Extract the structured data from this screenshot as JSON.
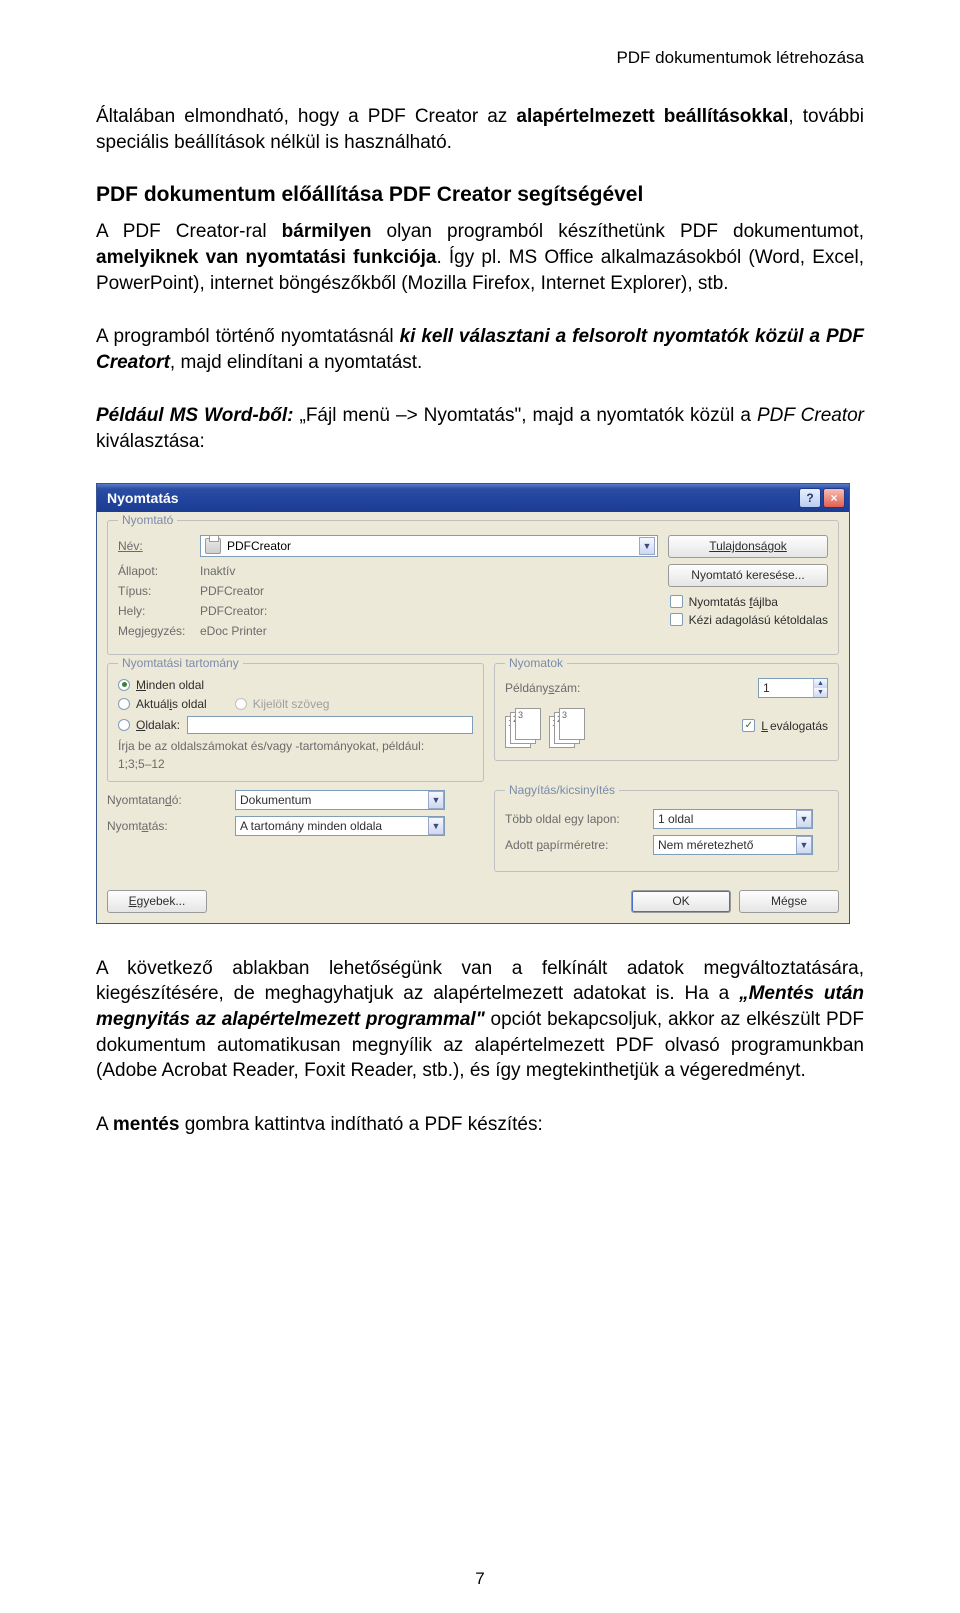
{
  "header_right": "PDF dokumentumok létrehozása",
  "p1_a": "Általában elmondható, hogy a PDF Creator az ",
  "p1_b": "alapértelmezett beállításokkal",
  "p1_c": ", további speciális beállítások nélkül is használható.",
  "h2": "PDF dokumentum előállítása PDF Creator segítségével",
  "p2_a": "A PDF Creator-ral ",
  "p2_b": "bármilyen",
  "p2_c": " olyan programból készíthetünk PDF dokumentumot, ",
  "p2_d": "amelyiknek van nyomtatási funkciója",
  "p2_e": ". Így pl. MS Office alkalmazásokból (Word, Excel, PowerPoint), internet böngészőkből (Mozilla Firefox, Internet Explorer), stb.",
  "p3_a": "A programból történő nyomtatásnál ",
  "p3_b": "ki kell választani a felsorolt nyomtatók közül a PDF Creatort",
  "p3_c": ", majd elindítani a nyomtatást.",
  "p4_a": "Például MS Word-ből:",
  "p4_b": " „Fájl menü –> Nyomtatás\", majd a nyomtatók közül a ",
  "p4_c": "PDF Creator",
  "p4_d": " kiválasztása:",
  "dialog": {
    "title": "Nyomtatás",
    "grp_printer": "Nyomtató",
    "lbl_name": "Név:",
    "name_value": "PDFCreator",
    "btn_props": "Tulajdonságok",
    "btn_find": "Nyomtató keresése...",
    "lbl_state": "Állapot:",
    "state_value": "Inaktív",
    "lbl_type": "Típus:",
    "type_value": "PDFCreator",
    "lbl_where": "Hely:",
    "where_value": "PDFCreator:",
    "lbl_comment": "Megjegyzés:",
    "comment_value": "eDoc Printer",
    "chk_tofile": "Nyomtatás fájlba",
    "chk_duplex": "Kézi adagolású kétoldalas",
    "grp_range": "Nyomtatási tartomány",
    "r_all": "Minden oldal",
    "r_cur": "Aktuális oldal",
    "r_sel": "Kijelölt szöveg",
    "r_pages": "Oldalak:",
    "range_hint1": "Írja be az oldalszámokat és/vagy -tartományokat, például:",
    "range_hint2": "1;3;5–12",
    "grp_copies": "Nyomatok",
    "lbl_copies": "Példányszám:",
    "copies_value": "1",
    "chk_collate": "Leválogatás",
    "lbl_printwhat": "Nyomtatandó:",
    "printwhat_value": "Dokumentum",
    "lbl_printrange": "Nyomtatás:",
    "printrange_value": "A tartomány minden oldala",
    "grp_scale": "Nagyítás/kicsinyítés",
    "lbl_persheet": "Több oldal egy lapon:",
    "persheet_value": "1 oldal",
    "lbl_paper": "Adott papírméretre:",
    "paper_value": "Nem méretezhető",
    "btn_more": "Egyebek...",
    "btn_ok": "OK",
    "btn_cancel": "Mégse"
  },
  "p5_a": "A következő ablakban lehetőségünk van a felkínált adatok megváltoztatására, kiegészítésére, de meghagyhatjuk az alapértelmezett adatokat is. Ha a ",
  "p5_b": "„Mentés után megnyitás az alapértelmezett programmal\"",
  "p5_c": " opciót bekapcsoljuk, akkor az elkészült PDF dokumentum automatikusan megnyílik az alapértelmezett PDF olvasó programunkban (Adobe Acrobat Reader, Foxit Reader, stb.), és így megtekinthetjük a végeredményt.",
  "p6_a": "A ",
  "p6_b": "mentés",
  "p6_c": " gombra kattintva indítható a PDF készítés:",
  "pagenum": "7"
}
